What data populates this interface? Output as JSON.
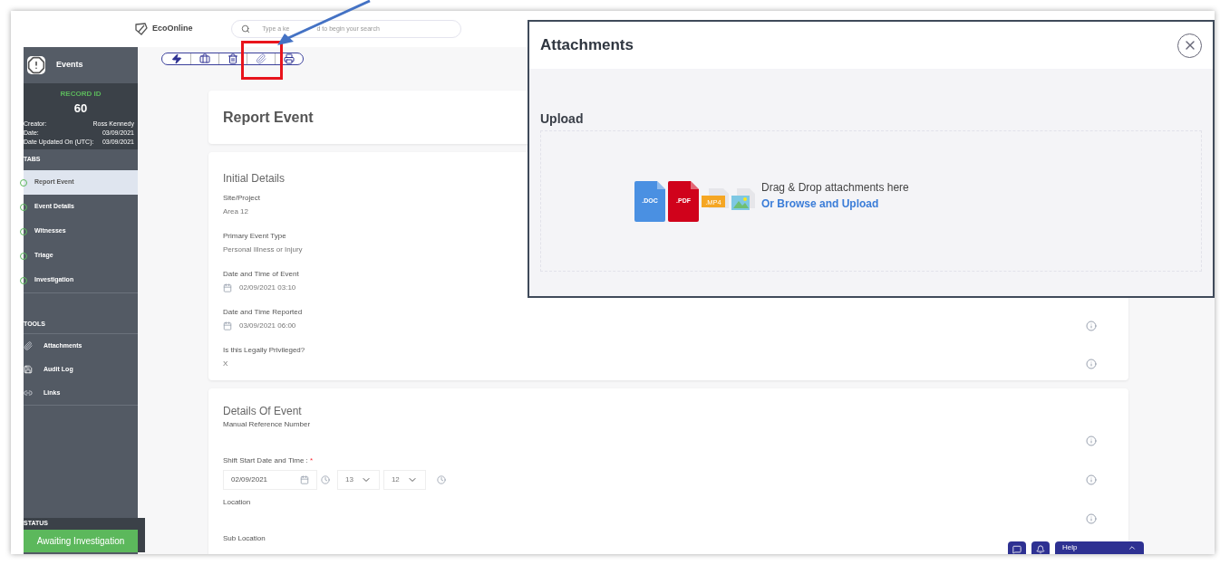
{
  "header": {
    "logo": "EcoOnline",
    "search": {
      "placeholder_parts": [
        "Type a ke",
        "d to begin your search"
      ]
    }
  },
  "sidebar": {
    "module": "Events",
    "record_label": "RECORD ID",
    "record_id": "60",
    "meta": [
      {
        "label": "Creator:",
        "value": "Ross Kennedy"
      },
      {
        "label": "Date:",
        "value": "03/09/2021"
      },
      {
        "label": "Date Updated On (UTC):",
        "value": "03/09/2021"
      }
    ],
    "tabs_label": "TABS",
    "tabs": [
      {
        "label": "Report Event",
        "selected": true
      },
      {
        "label": "Event Details",
        "selected": false
      },
      {
        "label": "Witnesses",
        "selected": false
      },
      {
        "label": "Triage",
        "selected": false
      },
      {
        "label": "Investigation",
        "selected": false
      }
    ],
    "tools_label": "TOOLS",
    "tools": [
      {
        "kind": "attachments",
        "label": "Attachments"
      },
      {
        "kind": "audit",
        "label": "Audit Log"
      },
      {
        "kind": "links",
        "label": "Links"
      }
    ],
    "status_label": "STATUS",
    "status": "Awaiting Investigation"
  },
  "toolbar": [
    {
      "kind": "bolt"
    },
    {
      "kind": "briefcase"
    },
    {
      "kind": "delete"
    },
    {
      "kind": "attach"
    },
    {
      "kind": "print"
    }
  ],
  "page_title": "Report Event",
  "sections": [
    {
      "title": "Initial Details",
      "fields": [
        {
          "kind": "text",
          "label": "Site/Project",
          "value": "Area 12"
        },
        {
          "kind": "text",
          "label": "Primary Event Type",
          "value": "Personal Illness or Injury"
        },
        {
          "kind": "datetime",
          "label": "Date and Time of Event",
          "value": "02/09/2021 03:10"
        },
        {
          "kind": "datetime",
          "label": "Date and Time Reported",
          "value": "03/09/2021 06:00",
          "help": true
        },
        {
          "kind": "text",
          "label": "Is this Legally Privileged?",
          "value": "X",
          "help": true
        }
      ]
    },
    {
      "title": "Details Of Event",
      "fields": [
        {
          "kind": "input",
          "label": "Manual Reference Number",
          "help": true
        },
        {
          "kind": "date_time_input",
          "label": "Shift Start Date and Time :",
          "required_mark": "*",
          "date": "02/09/2021",
          "hour": "13",
          "minute": "12",
          "help": true
        },
        {
          "kind": "input",
          "label": "Location",
          "help": true
        },
        {
          "kind": "input",
          "label": "Sub Location"
        }
      ]
    }
  ],
  "floating": {
    "help_label": "Help"
  },
  "modal": {
    "title": "Attachments",
    "section": "Upload",
    "drop_text": "Drag & Drop attachments here",
    "browse_link": "Or Browse and Upload",
    "file_icons": [
      {
        "kind": "document",
        "label": ".DOC",
        "color": "#4a90e2"
      },
      {
        "kind": "document",
        "label": ".PDF",
        "color": "#d0021b"
      },
      {
        "kind": "small",
        "label": ".MP4",
        "color": "#f5a623"
      },
      {
        "kind": "image",
        "color": "#7ec8e3"
      }
    ]
  }
}
